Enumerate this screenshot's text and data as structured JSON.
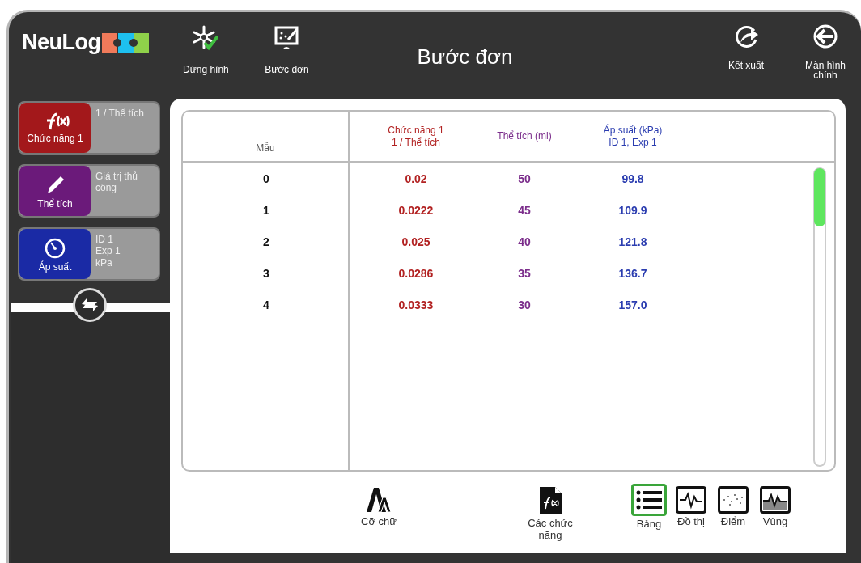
{
  "logo": {
    "text": "NeuLog"
  },
  "toolbar": [
    {
      "kind": "freeze",
      "label": "Dừng hình"
    },
    {
      "kind": "step",
      "label": "Bước đơn"
    }
  ],
  "title": "Bước đơn",
  "actions": [
    {
      "kind": "export",
      "label": "Kết xuất"
    },
    {
      "kind": "home",
      "label": "Màn hình chính"
    }
  ],
  "modules": [
    {
      "kind": "function",
      "name": "Chức năng 1",
      "info": [
        "1 / Thể tích"
      ],
      "color": "#a3181b"
    },
    {
      "kind": "manual",
      "name": "Thể tích",
      "info": [
        "Giá trị thủ",
        "công"
      ],
      "color": "#6b1a7a"
    },
    {
      "kind": "sensor",
      "name": "Áp suất",
      "info": [
        "ID 1",
        "Exp 1",
        "kPa"
      ],
      "color": "#1a2aa5"
    }
  ],
  "table": {
    "columns": [
      {
        "lines": [
          "Mẫu"
        ],
        "color": "#555555"
      },
      {
        "lines": [
          "Chức năng 1",
          "1 / Thể tích"
        ],
        "color": "#b22222"
      },
      {
        "lines": [
          "Thể tích (ml)"
        ],
        "color": "#7b2d8b"
      },
      {
        "lines": [
          "Áp suất (kPa)",
          "ID 1, Exp 1"
        ],
        "color": "#2b3db0"
      }
    ],
    "rows": [
      [
        "0",
        "0.02",
        "50",
        "99.8"
      ],
      [
        "1",
        "0.0222",
        "45",
        "109.9"
      ],
      [
        "2",
        "0.025",
        "40",
        "121.8"
      ],
      [
        "3",
        "0.0286",
        "35",
        "136.7"
      ],
      [
        "4",
        "0.0333",
        "30",
        "157.0"
      ]
    ]
  },
  "tools": [
    {
      "kind": "font-size",
      "label": "Cỡ chữ"
    },
    {
      "kind": "functions",
      "label": "Các chức năng"
    }
  ],
  "views": [
    {
      "kind": "table",
      "label": "Bảng",
      "selected": true
    },
    {
      "kind": "graph",
      "label": "Đồ thị",
      "selected": false
    },
    {
      "kind": "points",
      "label": "Điểm",
      "selected": false
    },
    {
      "kind": "area",
      "label": "Vùng",
      "selected": false
    }
  ]
}
